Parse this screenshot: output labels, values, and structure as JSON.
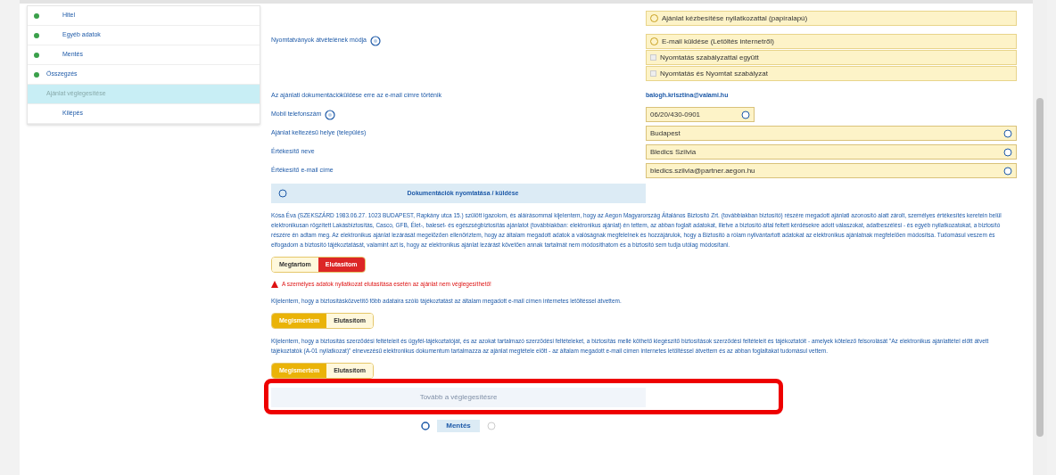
{
  "sidebar": {
    "items": [
      {
        "label": "Hitel",
        "selected": false,
        "done": true
      },
      {
        "label": "Egyéb adatok",
        "selected": false,
        "done": true
      },
      {
        "label": "Mentés",
        "selected": false,
        "done": true
      },
      {
        "label": "Összegzés",
        "selected": false,
        "done": true
      },
      {
        "label": "Ajánlat véglegesítése",
        "selected": true,
        "done": false
      },
      {
        "label": "Kilépés",
        "selected": false,
        "done": false
      }
    ]
  },
  "delivery": {
    "label": "Nyomtatványok átvételének módja",
    "options": [
      {
        "kind": "radio",
        "label": "Ajánlat kézbesítése nyilatkozattal (papíralapú)",
        "checked": false
      },
      {
        "kind": "radio",
        "label": "E-mail küldése (Letöltés internetről)",
        "checked": false
      },
      {
        "kind": "checkbox",
        "label": "Nyomtatás szabályzattal együtt",
        "checked": false
      },
      {
        "kind": "checkbox",
        "label": "Nyomtatás és Nyomtat szabályzat",
        "checked": false
      }
    ]
  },
  "fields": [
    {
      "kind": "text",
      "label": "Az ajánlati dokumentációküldése erre az e-mail címre történik",
      "value": "balogh.krisztina@valami.hu"
    },
    {
      "kind": "short",
      "label": "Mobil telefonszám",
      "info": true,
      "value": "06/20/430-0901"
    },
    {
      "kind": "input",
      "label": "Ajánlat keltezésű helye (település)",
      "value": "Budapest"
    },
    {
      "kind": "input",
      "label": "Értékesítő neve",
      "value": "Bledics Szilvia"
    },
    {
      "kind": "input",
      "label": "Értékesítő e-mail címe",
      "value": "bledics.szilvia@partner.aegon.hu"
    }
  ],
  "print_button": "Dokumentációk nyomtatása / küldése",
  "consents": [
    {
      "text": "Kósa Éva (SZEKSZÁRD 1983.06.27. 1023 BUDAPEST, Rapkány utca 15.) szülött igazolom, és aláírásommal kijelentem, hogy az Aegon Magyarország Általános Biztosító Zrt. (továbbiakban biztosító) részére megadott ajánlati azonosító alatt zárolt, személyes értékesítés keretein belül elektronikusan rögzített Lakásbiztosítás, Casco, GFB, Élet-, baleset- és egészségbiztosítás ajánlatot (továbbiakban: elektronikus ajánlat) én tettem, az abban foglalt adatokat, illetve a biztosító által feltett kérdésekre adott válaszokat, adatbeszélési - és egyéb nyilatkozatokat, a biztosító részére én adtam meg. Az elektronikus ajánlat lezárását megelőzően ellenőriztem, hogy az általam megadott adatok a valóságnak megfelelnek és hozzájárulok, hogy a Biztosító a rólam nyilvántartott adatokat az elektronikus ajánlatnak megfelelően módosítsa. Tudomásul veszem és elfogadom a biztosító tájékoztatását, valamint azt is, hogy az elektronikus ajánlat lezárást követően annak tartalmát nem módosíthatom és a biztosító sem tudja utólag módosítani.",
      "options": [
        {
          "label": "Megtartom",
          "selected": false
        },
        {
          "label": "Elutasítom",
          "selected": true
        }
      ],
      "color": "#dc2626",
      "warning": "A személyes adatok nyilatkozat elutasítása esetén az ajánlat nem véglegesíthető!"
    },
    {
      "text": "Kijelentem, hogy a biztosításközvetítő főbb adataira szóló tájékoztatást az általam megadott e-mail címen internetes letöltéssel átvettem.",
      "options": [
        {
          "label": "Megismertem",
          "selected": true
        },
        {
          "label": "Elutasítom",
          "selected": false
        }
      ],
      "color": "#eab308"
    },
    {
      "text": "Kijelentem, hogy a biztosítás szerződési feltételeit és ügyfél-tájékoztatóját, és az azokat tartalmazó szerződési feltételeket, a biztosítás mellé köthető kiegészítő biztosítások szerződési feltételeit és tájékoztatóit - amelyek kötelező felsorolását \"Az elektronikus ajánlattétel előtt átvett tájékoztatók (A-01 nyilatkozat)\" elnevezésű elektronikus dokumentum tartalmazza az ajánlat megtétele előtt - az általam megadott e-mail címen internetes letöltéssel átvettem és az abban foglaltakat tudomásul vettem.",
      "options": [
        {
          "label": "Megismertem",
          "selected": true
        },
        {
          "label": "Elutasítom",
          "selected": false
        }
      ],
      "color": "#eab308"
    }
  ],
  "next_button": {
    "label": "Tovább a véglegesítésre",
    "disabled": true
  },
  "save_button": "Mentés"
}
